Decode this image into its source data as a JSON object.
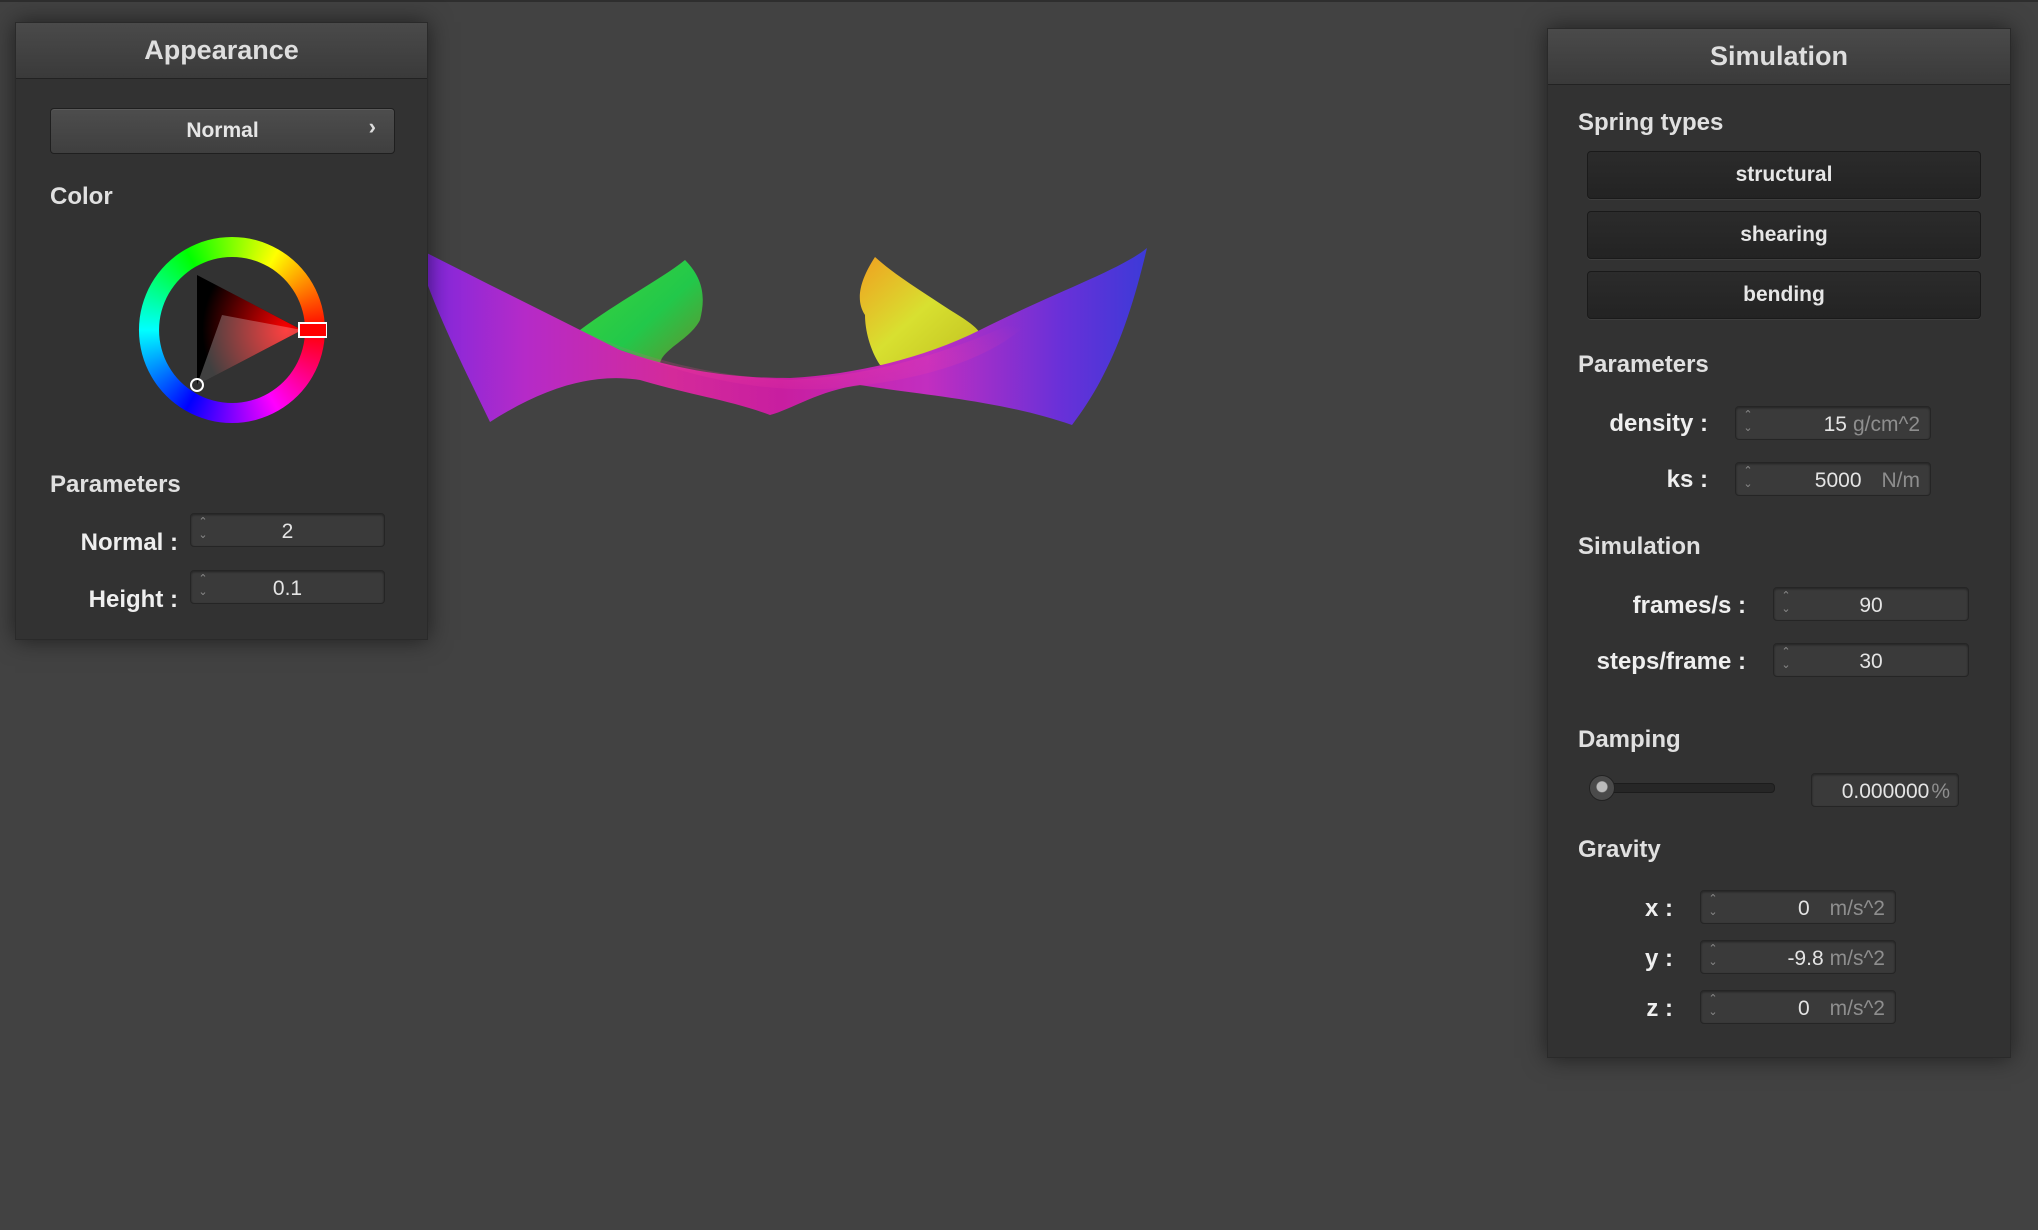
{
  "appearance": {
    "title": "Appearance",
    "mode_button": "Normal",
    "mode_chevron": "›",
    "color_label": "Color",
    "color_value": "#ff0000",
    "parameters_label": "Parameters",
    "normal_label": "Normal :",
    "normal_value": "2",
    "height_label": "Height :",
    "height_value": "0.1"
  },
  "simulation": {
    "title": "Simulation",
    "spring_types_label": "Spring types",
    "springs": [
      "structural",
      "shearing",
      "bending"
    ],
    "parameters_label": "Parameters",
    "density_label": "density :",
    "density_value": "15",
    "density_unit": "g/cm^2",
    "ks_label": "ks :",
    "ks_value": "5000",
    "ks_unit": "N/m",
    "simulation_label": "Simulation",
    "fps_label": "frames/s :",
    "fps_value": "90",
    "steps_label": "steps/frame :",
    "steps_value": "30",
    "damping_label": "Damping",
    "damping_fraction": 0.0,
    "damping_value": "0.000000",
    "damping_unit": "%",
    "gravity_label": "Gravity",
    "x_label": "x :",
    "x_value": "0",
    "y_label": "y :",
    "y_value": "-9.8",
    "z_label": "z :",
    "z_value": "0",
    "gravity_unit": "m/s^2"
  },
  "colors": {
    "background": "#424242",
    "panel": "#323232"
  }
}
